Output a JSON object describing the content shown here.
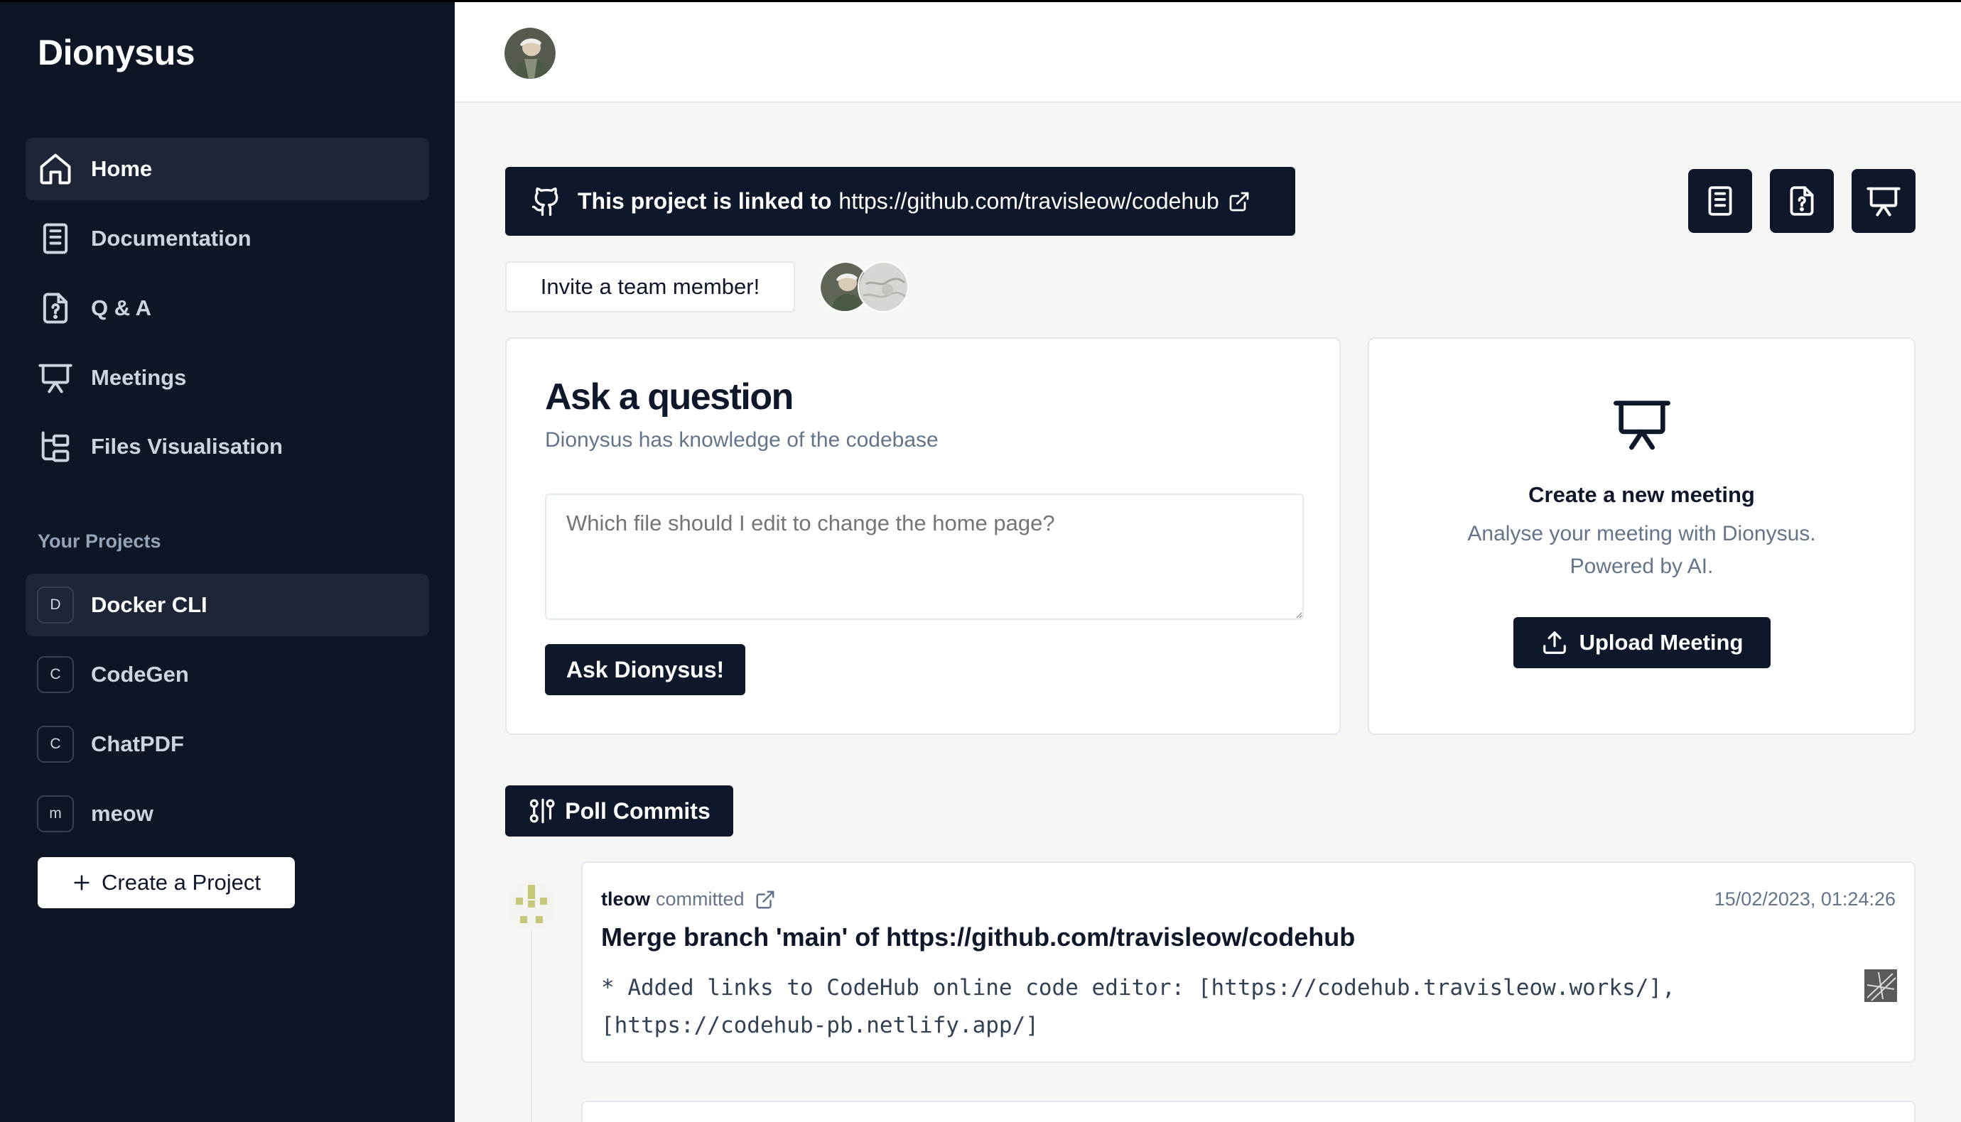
{
  "app": {
    "name": "Dionysus"
  },
  "sidebar": {
    "nav": [
      {
        "label": "Home",
        "icon": "home-icon",
        "active": true
      },
      {
        "label": "Documentation",
        "icon": "document-icon",
        "active": false
      },
      {
        "label": "Q & A",
        "icon": "question-file-icon",
        "active": false
      },
      {
        "label": "Meetings",
        "icon": "presentation-icon",
        "active": false
      },
      {
        "label": "Files Visualisation",
        "icon": "folder-tree-icon",
        "active": false
      }
    ],
    "projects_label": "Your Projects",
    "projects": [
      {
        "initial": "D",
        "name": "Docker CLI",
        "active": true
      },
      {
        "initial": "C",
        "name": "CodeGen",
        "active": false
      },
      {
        "initial": "C",
        "name": "ChatPDF",
        "active": false
      },
      {
        "initial": "m",
        "name": "meow",
        "active": false
      }
    ],
    "create_label": "Create a Project"
  },
  "banner": {
    "prefix": "This project is linked to",
    "url": "https://github.com/travisleow/codehub"
  },
  "toolbar_icons": [
    "document-icon",
    "question-file-icon",
    "presentation-icon"
  ],
  "invite": {
    "label": "Invite a team member!"
  },
  "ask": {
    "title": "Ask a question",
    "subtitle": "Dionysus has knowledge of the codebase",
    "placeholder": "Which file should I edit to change the home page?",
    "button": "Ask Dionysus!"
  },
  "meeting": {
    "title": "Create a new meeting",
    "subtitle": "Analyse your meeting with Dionysus. Powered by AI.",
    "button": "Upload Meeting"
  },
  "poll": {
    "label": "Poll Commits"
  },
  "commits": [
    {
      "author": "tleow",
      "verb": "committed",
      "date": "15/02/2023, 01:24:26",
      "message": "Merge branch 'main' of https://github.com/travisleow/codehub",
      "body": "* Added links to CodeHub online code editor: [https://codehub.travisleow.works/],\n[https://codehub-pb.netlify.app/]"
    }
  ],
  "colors": {
    "sidebar_bg": "#0e1525",
    "primary": "#0f172a",
    "muted": "#64748b"
  }
}
